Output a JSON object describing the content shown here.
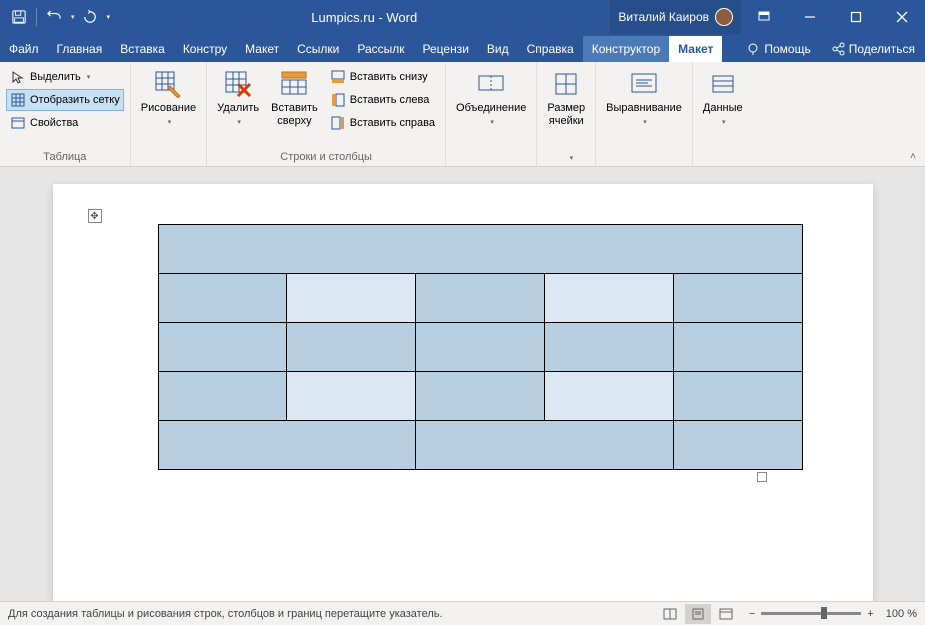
{
  "title": "Lumpics.ru  -  Word",
  "user": {
    "name": "Виталий Каиров"
  },
  "tabs": {
    "file": "Файл",
    "home": "Главная",
    "insert": "Вставка",
    "design": "Констру",
    "layout": "Макет",
    "references": "Ссылки",
    "mailings": "Рассылк",
    "review": "Рецензи",
    "view": "Вид",
    "help": "Справка",
    "tbl_design": "Конструктор",
    "tbl_layout": "Макет",
    "tell_me": "Помощь",
    "share": "Поделиться"
  },
  "ribbon": {
    "table_group": {
      "label": "Таблица",
      "select": "Выделить",
      "gridlines": "Отобразить сетку",
      "properties": "Свойства"
    },
    "draw": {
      "label": "Рисование"
    },
    "delete": {
      "label": "Удалить"
    },
    "rows_cols": {
      "label": "Строки и столбцы",
      "insert_above": "Вставить\nсверху",
      "insert_below": "Вставить снизу",
      "insert_left": "Вставить слева",
      "insert_right": "Вставить справа"
    },
    "merge": {
      "label": "Объединение"
    },
    "cell_size": {
      "label": "Размер\nячейки"
    },
    "alignment": {
      "label": "Выравнивание"
    },
    "data": {
      "label": "Данные"
    }
  },
  "statusbar": {
    "hint": "Для создания таблицы и рисования строк, столбцов и границ перетащите указатель.",
    "zoom": "100 %"
  }
}
